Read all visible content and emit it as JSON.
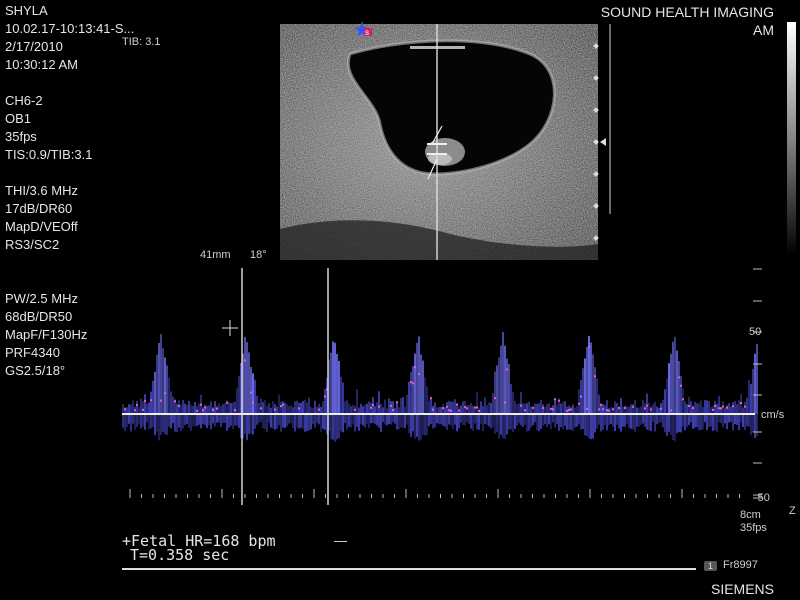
{
  "patient": {
    "name": "SHYLA",
    "id": "10.02.17-10:13:41-S...",
    "date": "2/17/2010",
    "time": "10:30:12 AM",
    "tib_overlay": "TIB: 3.1"
  },
  "header": {
    "facility": "SOUND HEALTH IMAGING",
    "am": "AM"
  },
  "transducer": {
    "probe": "CH6-2",
    "preset": "OB1",
    "framerate": "35fps",
    "thermal": "TIS:0.9/TIB:3.1"
  },
  "bmode_params": {
    "freq": "THI/3.6 MHz",
    "gain": "17dB/DR60",
    "map": "MapD/VEOff",
    "rs": "RS3/SC2"
  },
  "pw_params": {
    "freq": "PW/2.5 MHz",
    "gain": "68dB/DR50",
    "map": "MapF/F130Hz",
    "prf": "PRF4340",
    "gs": "GS2.5/18°"
  },
  "gate": {
    "depth": "41mm",
    "angle": "18°"
  },
  "scale": {
    "top": "50",
    "unit": "cm/s",
    "bottom": "-50",
    "depth": "8cm",
    "fps": "35fps",
    "z": "Z"
  },
  "measurement": {
    "hr": "Fetal HR=168 bpm",
    "t": "T=0.358 sec",
    "dash": "—"
  },
  "footer": {
    "badge": "1",
    "frame": "Fr8997",
    "brand": "SIEMENS"
  },
  "doppler_data": {
    "peaks": [
      160,
      245,
      333,
      417,
      502,
      588,
      673,
      758
    ],
    "calipers": [
      242,
      328
    ]
  }
}
